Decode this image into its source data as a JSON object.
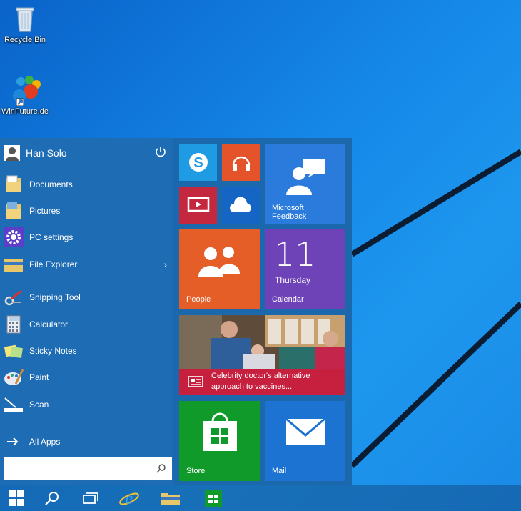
{
  "desktop": {
    "icons": [
      {
        "label": "Recycle Bin",
        "icon": "recycle-bin-icon"
      },
      {
        "label": "WinFuture.de",
        "icon": "winfuture-shortcut-icon"
      }
    ]
  },
  "start_menu": {
    "user": {
      "name": "Han Solo",
      "icon": "user-avatar-icon",
      "power_icon": "power-icon"
    },
    "pinned": [
      {
        "label": "Documents",
        "icon": "documents-folder-icon"
      },
      {
        "label": "Pictures",
        "icon": "pictures-folder-icon"
      },
      {
        "label": "PC settings",
        "icon": "gear-icon"
      },
      {
        "label": "File Explorer",
        "icon": "file-explorer-icon",
        "chevron": "›"
      }
    ],
    "apps": [
      {
        "label": "Snipping Tool",
        "icon": "snipping-tool-icon"
      },
      {
        "label": "Calculator",
        "icon": "calculator-icon"
      },
      {
        "label": "Sticky Notes",
        "icon": "sticky-notes-icon"
      },
      {
        "label": "Paint",
        "icon": "paint-icon"
      },
      {
        "label": "Scan",
        "icon": "scan-icon"
      }
    ],
    "all_apps": {
      "label": "All Apps",
      "icon": "arrow-right-icon"
    },
    "search": {
      "value": "",
      "icon": "search-icon"
    },
    "tiles": {
      "skype": {
        "label": "",
        "icon": "skype-icon",
        "color": "#1e9be3"
      },
      "music": {
        "label": "",
        "icon": "headphones-icon",
        "color": "#e5532a"
      },
      "video": {
        "label": "",
        "icon": "video-icon",
        "color": "#c3283f"
      },
      "onedrive": {
        "label": "",
        "icon": "cloud-icon",
        "color": "#1565c4"
      },
      "feedback": {
        "label_line1": "Microsoft",
        "label_line2": "Feedback",
        "icon": "feedback-icon",
        "color": "#2a7bdc"
      },
      "people": {
        "label": "People",
        "icon": "people-icon",
        "color": "#e55e27"
      },
      "calendar": {
        "label": "Calendar",
        "day": "11",
        "weekday": "Thursday",
        "color": "#6e43b8"
      },
      "news": {
        "headline_line1": "Celebrity doctor's alternative",
        "headline_line2": "approach to vaccines...",
        "icon": "news-icon",
        "color": "#c7203f"
      },
      "store": {
        "label": "Store",
        "icon": "store-bag-icon",
        "color": "#109a2a"
      },
      "mail": {
        "label": "Mail",
        "icon": "mail-envelope-icon",
        "color": "#1d73d1"
      }
    }
  },
  "taskbar": {
    "items": [
      {
        "name": "start-button",
        "icon": "windows-logo-icon"
      },
      {
        "name": "search-button",
        "icon": "search-icon"
      },
      {
        "name": "task-view-button",
        "icon": "task-view-icon"
      },
      {
        "name": "internet-explorer-button",
        "icon": "internet-explorer-icon"
      },
      {
        "name": "file-explorer-button",
        "icon": "folder-icon"
      },
      {
        "name": "store-button",
        "icon": "store-icon"
      }
    ]
  }
}
